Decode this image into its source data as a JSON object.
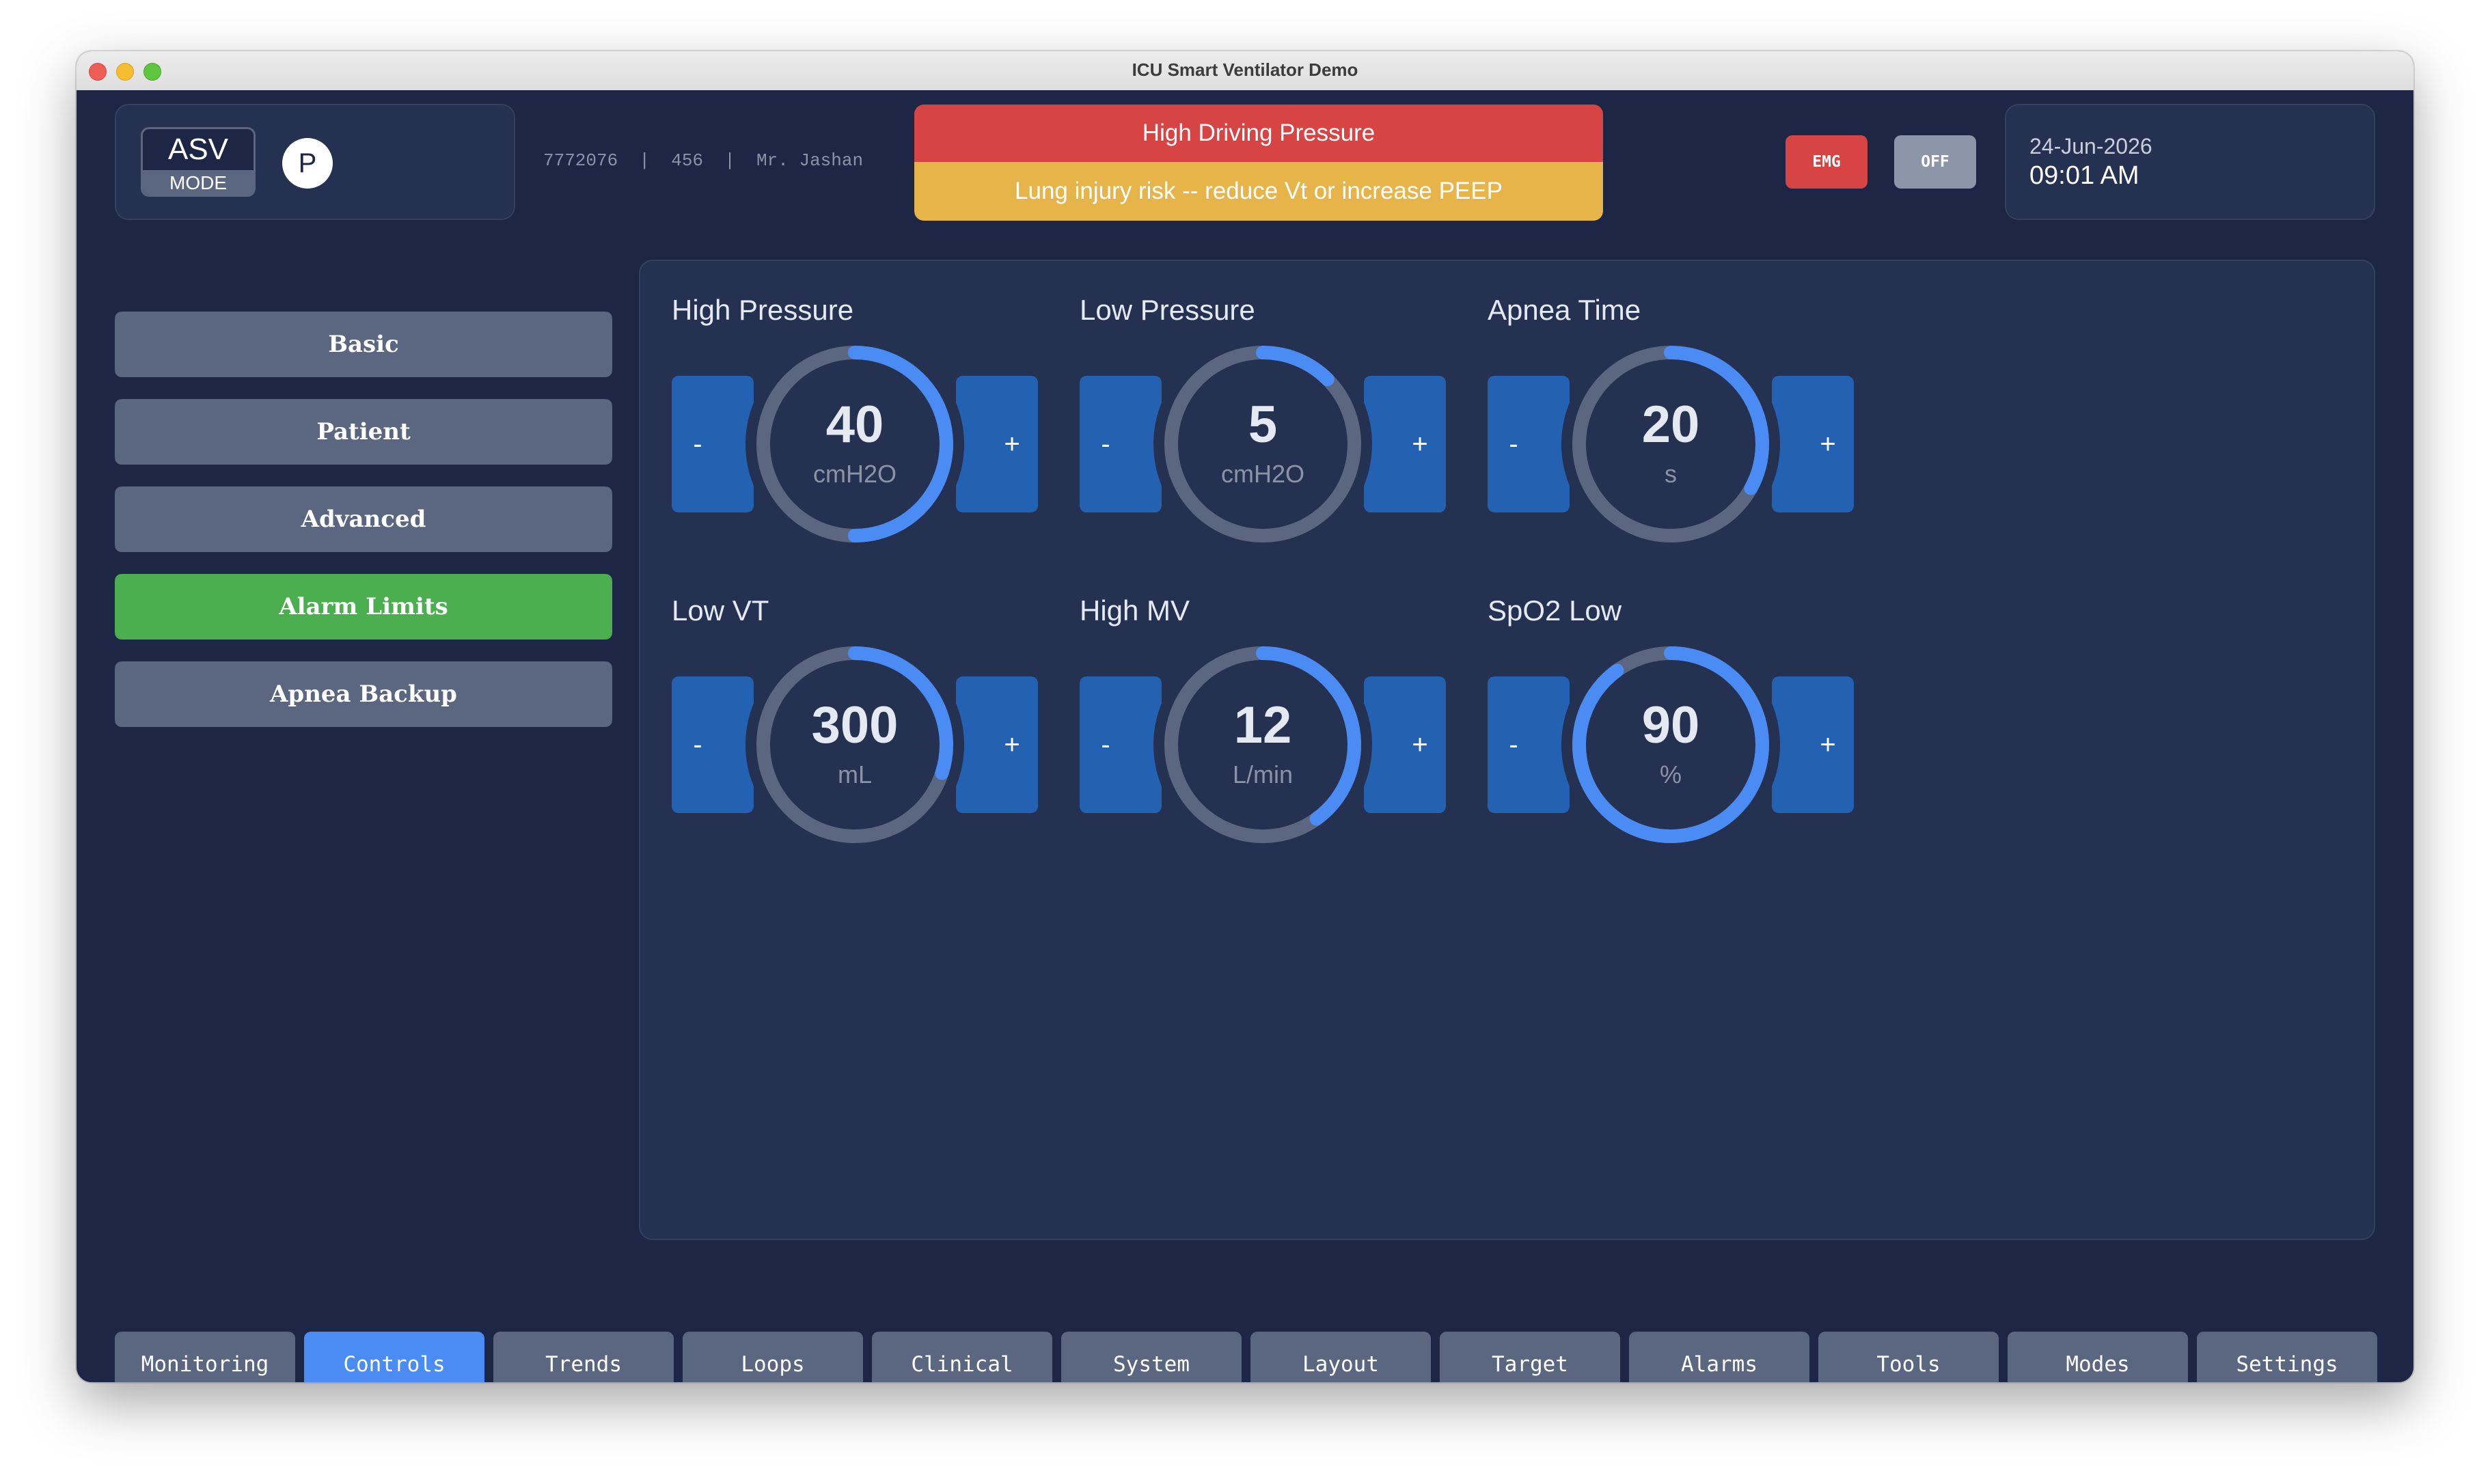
{
  "window": {
    "title": "ICU Smart Ventilator Demo"
  },
  "header": {
    "mode": {
      "value": "ASV",
      "label": "MODE"
    },
    "patient_type": "P",
    "patient_info": "7772076  |  456  |  Mr. Jashan",
    "alarm": {
      "title": "High Driving Pressure",
      "message": "Lung injury risk -- reduce Vt or increase PEEP"
    },
    "emg_label": "EMG",
    "off_label": "OFF",
    "date": "24-Jun-2026",
    "time": "09:01 AM"
  },
  "sidebar": {
    "items": [
      {
        "label": "Basic",
        "active": false
      },
      {
        "label": "Patient",
        "active": false
      },
      {
        "label": "Advanced",
        "active": false
      },
      {
        "label": "Alarm Limits",
        "active": true
      },
      {
        "label": "Apnea Backup",
        "active": false
      }
    ]
  },
  "controls": [
    {
      "label": "High Pressure",
      "value": "40",
      "unit": "cmH2O",
      "fill": 0.5
    },
    {
      "label": "Low Pressure",
      "value": "5",
      "unit": "cmH2O",
      "fill": 0.125
    },
    {
      "label": "Apnea Time",
      "value": "20",
      "unit": "s",
      "fill": 0.33
    },
    {
      "label": "Low VT",
      "value": "300",
      "unit": "mL",
      "fill": 0.3
    },
    {
      "label": "High MV",
      "value": "12",
      "unit": "L/min",
      "fill": 0.4
    },
    {
      "label": "SpO2 Low",
      "value": "90",
      "unit": "%",
      "fill": 0.9
    }
  ],
  "stepper": {
    "minus": "-",
    "plus": "+"
  },
  "bottom_nav": {
    "items": [
      {
        "label": "Monitoring",
        "active": false
      },
      {
        "label": "Controls",
        "active": true
      },
      {
        "label": "Trends",
        "active": false
      },
      {
        "label": "Loops",
        "active": false
      },
      {
        "label": "Clinical",
        "active": false
      },
      {
        "label": "System",
        "active": false
      },
      {
        "label": "Layout",
        "active": false
      },
      {
        "label": "Target",
        "active": false
      },
      {
        "label": "Alarms",
        "active": false
      },
      {
        "label": "Tools",
        "active": false
      },
      {
        "label": "Modes",
        "active": false
      },
      {
        "label": "Settings",
        "active": false
      }
    ]
  },
  "colors": {
    "background": "#1d2745",
    "panel": "#253150",
    "accent_blue": "#4a8bf4",
    "stepper_blue": "#2361b3",
    "active_green": "#4baf50",
    "alarm_red": "#d64444",
    "alarm_yellow": "#e6b448",
    "gauge_track": "#5b6680"
  }
}
